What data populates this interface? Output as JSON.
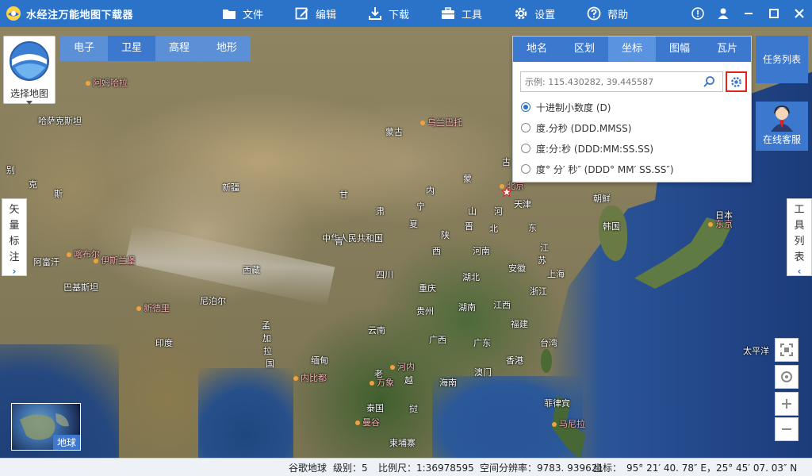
{
  "app": {
    "title": "水经注万能地图下载器",
    "menu": [
      {
        "label": "文件",
        "icon": "folder-icon"
      },
      {
        "label": "编辑",
        "icon": "edit-icon"
      },
      {
        "label": "下载",
        "icon": "download-icon"
      },
      {
        "label": "工具",
        "icon": "toolbox-icon"
      },
      {
        "label": "设置",
        "icon": "gear-icon"
      },
      {
        "label": "帮助",
        "icon": "help-icon"
      }
    ],
    "accent_color": "#2a73c8"
  },
  "map_selector": {
    "label": "选择地图"
  },
  "map_tabs": [
    {
      "label": "电子",
      "active": false
    },
    {
      "label": "卫星",
      "active": true
    },
    {
      "label": "高程",
      "active": false
    },
    {
      "label": "地形",
      "active": false
    }
  ],
  "left_tab": {
    "chars": [
      "矢",
      "量",
      "标",
      "注"
    ],
    "arrow": "›"
  },
  "right_tab": {
    "chars": [
      "工",
      "具",
      "列",
      "表"
    ],
    "arrow": "‹"
  },
  "task_list": {
    "label": "任务列表"
  },
  "online_service": {
    "label": "在线客服"
  },
  "search_panel": {
    "tabs": [
      {
        "label": "地名",
        "active": false
      },
      {
        "label": "区划",
        "active": false
      },
      {
        "label": "坐标",
        "active": true
      },
      {
        "label": "图幅",
        "active": false
      },
      {
        "label": "瓦片",
        "active": false
      }
    ],
    "placeholder": "示例: 115.430282, 39.445587",
    "options": [
      {
        "label": "十进制小数度 (D)",
        "selected": true
      },
      {
        "label": "度.分秒 (DDD.MMSS)",
        "selected": false
      },
      {
        "label": "度:分:秒 (DDD:MM:SS.SS)",
        "selected": false
      },
      {
        "label": "度° 分′ 秒″ (DDD° MM′ SS.SS″)",
        "selected": false
      }
    ]
  },
  "mini_globe": {
    "label": "地球"
  },
  "places": {
    "ahm": "阿姆哈拉",
    "uly": "乌兰巴托",
    "kaz": "哈萨克斯坦",
    "mng": "蒙古",
    "bie": "别",
    "ke": "克",
    "si": "斯",
    "xj": "新疆",
    "gan": "甘",
    "nei": "内",
    "meng": "蒙",
    "gu": "古",
    "bj": "北京",
    "tj": "天津",
    "ning": "宁",
    "su": "肃",
    "xia": "夏",
    "shan": "山",
    "he": "河",
    "bei": "北",
    "dong": "东",
    "jin": "晋",
    "shx": "陕",
    "xi": "西",
    "hn": "河南",
    "ah": "安徽",
    "js": "江",
    "su2": "苏",
    "sh": "上海",
    "zj": "浙江",
    "prc": "中华人民共和国",
    "qh": "青",
    "xz": "西藏",
    "sc": "四川",
    "cq": "重庆",
    "hb": "湖北",
    "gz": "贵州",
    "hun": "湖南",
    "jx": "江西",
    "fj": "福建",
    "tw": "台湾",
    "gx": "广西",
    "gd": "广东",
    "yn": "云南",
    "hk": "香港",
    "mc": "澳门",
    "hainan": "海南",
    "nk": "朝鲜",
    "sk": "韩国",
    "jp": "日本",
    "tokyo": "东京",
    "pac": "太平洋",
    "afg": "阿富汗",
    "kbl": "喀布尔",
    "isb": "伊斯兰堡",
    "pak": "巴基斯坦",
    "ndl": "新德里",
    "npl": "尼泊尔",
    "ind": "印度",
    "bgd1": "孟",
    "bgd2": "加",
    "bgd3": "拉",
    "bgd4": "国",
    "mmr": "缅甸",
    "lao": "老",
    "vte": "万象",
    "vie": "越",
    "hni": "河内",
    "npt": "内比都",
    "tha": "泰国",
    "khm": "柬埔寨",
    "bkk": "曼谷",
    "phl": "菲律宾",
    "mnl": "马尼拉",
    "pu": "挝"
  },
  "statusbar": {
    "source": "谷歌地球",
    "level": "级别：5",
    "scale": "比例尺：1:36978595",
    "resolution": "空间分辨率：9783. 939621",
    "coord": "坐标：　95° 21′ 40. 78″ E，25° 45′ 07. 03″ N"
  }
}
